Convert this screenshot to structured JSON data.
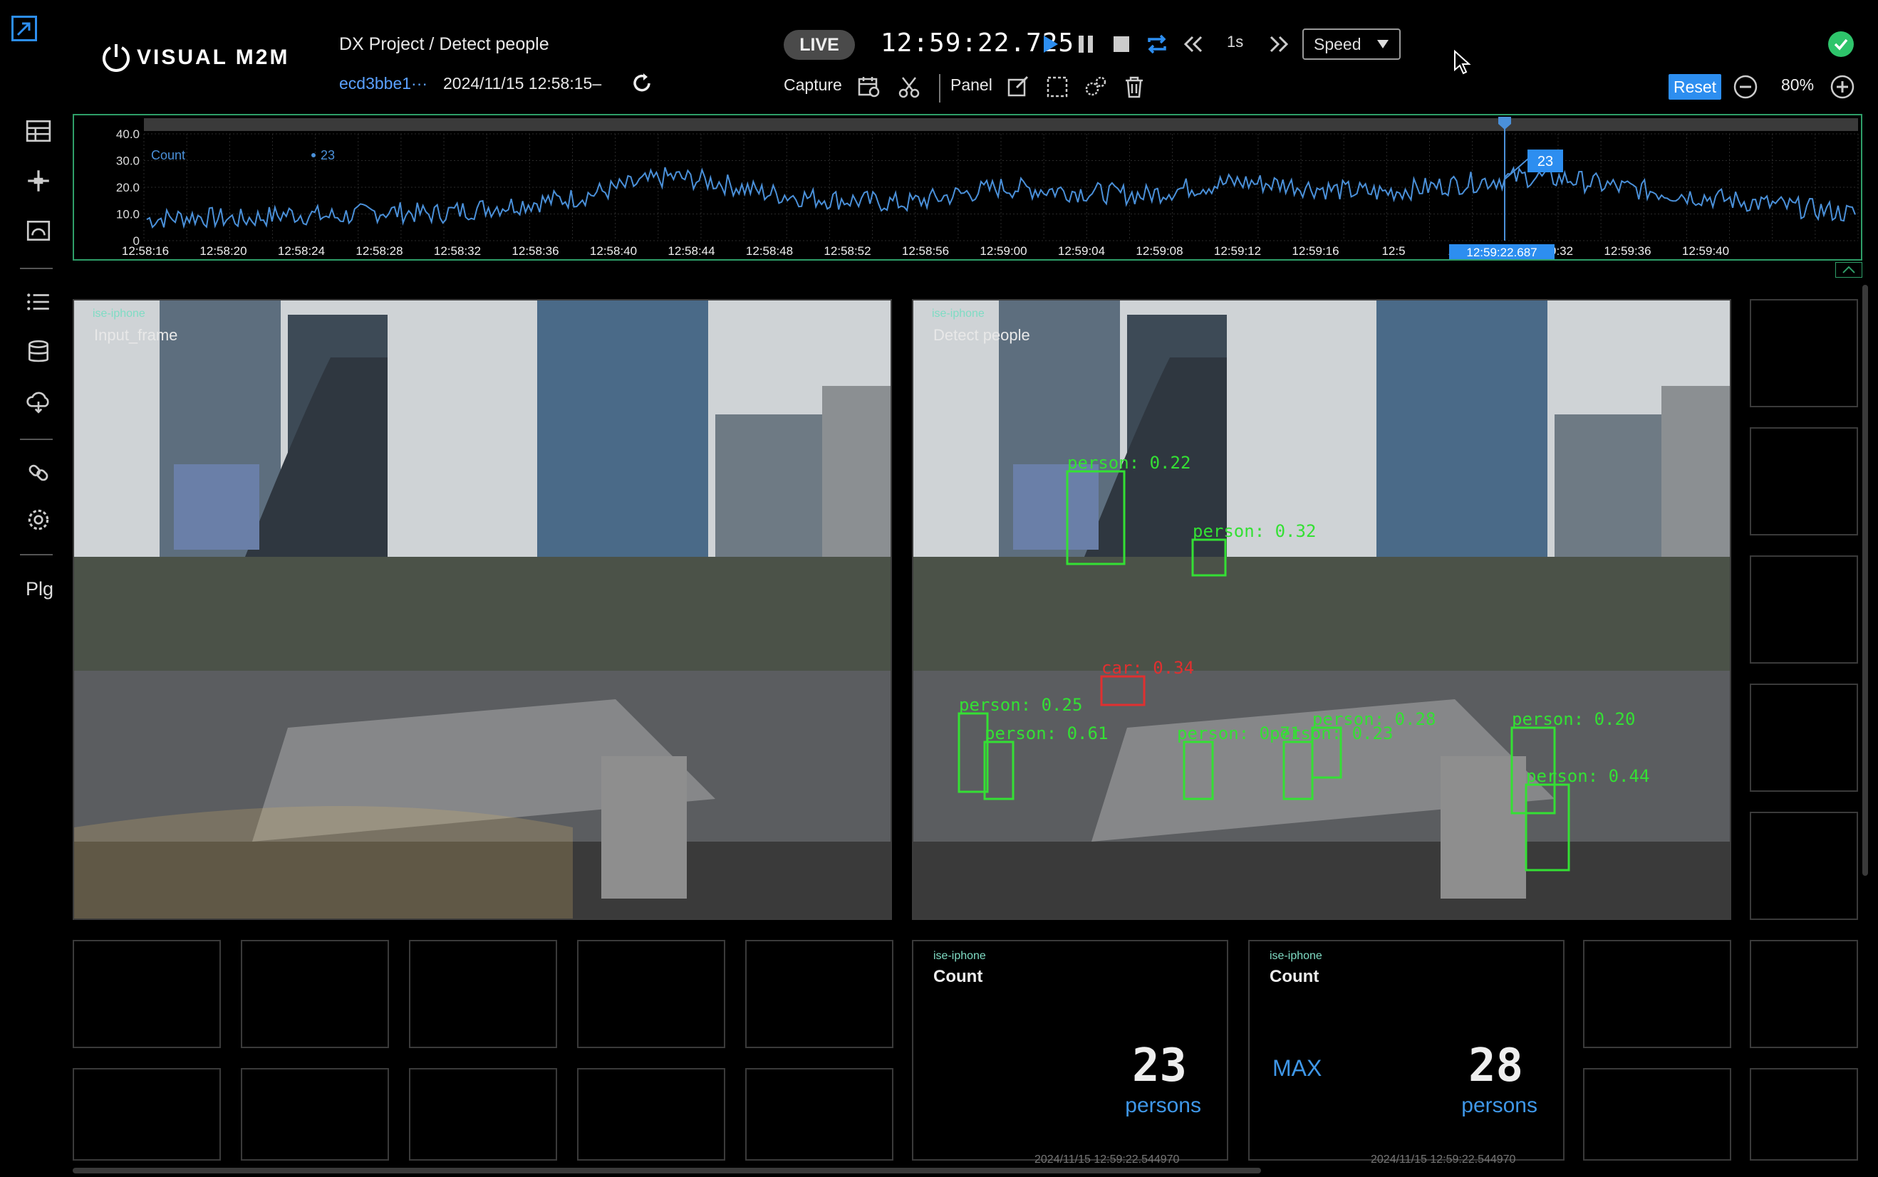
{
  "header": {
    "logo_text": "VISUAL M2M",
    "breadcrumb": "DX Project / Detect people",
    "pipeline_id": "ecd3bbe1···",
    "start_time": "2024/11/15 12:58:15–",
    "live_label": "LIVE",
    "clock": "12:59:22.725",
    "step": "1s",
    "speed_label": "Speed",
    "capture_label": "Capture",
    "panel_label": "Panel",
    "reset_label": "Reset",
    "zoom": "80%"
  },
  "sidebar": {
    "plugin_label": "Plg",
    "icons": [
      "dashboard-icon",
      "pipeline-icon",
      "camera-icon",
      "list-icon",
      "database-icon",
      "cloud-upload-icon",
      "link-icon",
      "settings-icon"
    ]
  },
  "colors": {
    "accent": "#2d8ef0",
    "status_ok": "#2ec46b",
    "timeline_border": "#2e9e68",
    "series": "#4a90d9",
    "detection_box": "#34e034",
    "car_box": "#e03030"
  },
  "chart_data": {
    "type": "line",
    "series": [
      {
        "name": "Count",
        "values": [
          8,
          9,
          8,
          10,
          9,
          11,
          10,
          12,
          14,
          16,
          20,
          24,
          22,
          18,
          16,
          15,
          14,
          17,
          20,
          19,
          18,
          17,
          20,
          22,
          21,
          19,
          18,
          20,
          22,
          24,
          23,
          20,
          18,
          16,
          14,
          12,
          10
        ]
      }
    ],
    "x": [
      "12:58:16",
      "12:58:18",
      "12:58:20",
      "12:58:22",
      "12:58:24",
      "12:58:26",
      "12:58:28",
      "12:58:30",
      "12:58:32",
      "12:58:34",
      "12:58:36",
      "12:58:38",
      "12:58:40",
      "12:58:42",
      "12:58:44",
      "12:58:46",
      "12:58:48",
      "12:58:50",
      "12:58:52",
      "12:58:54",
      "12:58:56",
      "12:58:58",
      "12:59:00",
      "12:59:02",
      "12:59:04",
      "12:59:06",
      "12:59:08",
      "12:59:10",
      "12:59:12",
      "12:59:14",
      "12:59:16",
      "12:59:18",
      "12:59:20",
      "12:59:22",
      "12:59:24",
      "12:59:26",
      "12:59:28"
    ],
    "x_tick_labels": [
      "12:58:16",
      "12:58:20",
      "12:58:24",
      "12:58:28",
      "12:58:32",
      "12:58:36",
      "12:58:40",
      "12:58:44",
      "12:58:48",
      "12:58:52",
      "12:58:56",
      "12:59:00",
      "12:59:04",
      "12:59:08",
      "12:59:12",
      "12:59:16",
      "12:5",
      "12:59:28",
      "12:59:32",
      "12:59:36",
      "12:59:40"
    ],
    "y_tick_labels": [
      "40.0",
      "30.0",
      "20.0",
      "10.0",
      "0"
    ],
    "ylim": [
      0,
      40
    ],
    "legend": "Count",
    "legend_value": "23",
    "cursor_label": "12:59:22.687",
    "cursor_value": "23",
    "grid": true
  },
  "panels": {
    "left": {
      "tag": "ise-iphone",
      "name": "Input_frame"
    },
    "right": {
      "tag": "ise-iphone",
      "name": "Detect people"
    },
    "detections": [
      {
        "label": "person: 0.22"
      },
      {
        "label": "person: 0.32"
      },
      {
        "label": "car: 0.34"
      },
      {
        "label": "person: 0.25"
      },
      {
        "label": "person: 0.61"
      },
      {
        "label": "person: 0.71"
      },
      {
        "label": "person: 0.23"
      },
      {
        "label": "person: 0.28"
      },
      {
        "label": "person: 0.20"
      },
      {
        "label": "person: 0.44"
      }
    ]
  },
  "stats": [
    {
      "tag": "ise-iphone",
      "label": "Count",
      "value": "23",
      "unit": "persons",
      "prefix": "",
      "timestamp": "2024/11/15 12:59:22.544970"
    },
    {
      "tag": "ise-iphone",
      "label": "Count",
      "value": "28",
      "unit": "persons",
      "prefix": "MAX",
      "timestamp": "2024/11/15 12:59:22.544970"
    }
  ]
}
